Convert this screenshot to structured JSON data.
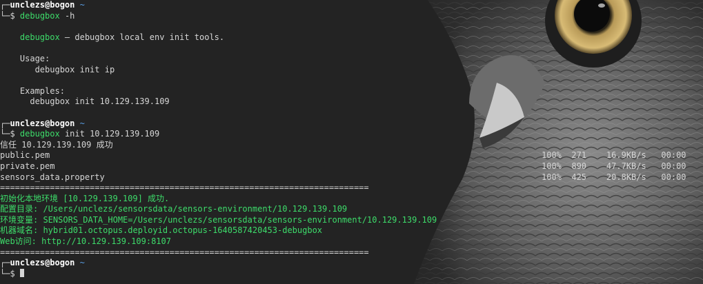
{
  "prompt": {
    "frame_top": "┌─",
    "frame_bottom": "└─",
    "user_host": "unclezs@bogon",
    "path": "~",
    "symbol": "$"
  },
  "session1": {
    "command_name": "debugbox",
    "command_args": " -h",
    "help_title_name": "debugbox",
    "help_title_rest": " — debugbox local env init tools.",
    "usage_label": "Usage:",
    "usage_cmd": "debugbox init ip",
    "examples_label": "Examples:",
    "examples_cmd": "debugbox init 10.129.139.109"
  },
  "session2": {
    "command_name": "debugbox",
    "command_args": " init 10.129.139.109",
    "trust_msg": "信任 10.129.139.109 成功",
    "transfers": [
      {
        "name": "public.pem",
        "stats": "100%  271    16.9KB/s   00:00"
      },
      {
        "name": "private.pem",
        "stats": "100%  890    47.7KB/s   00:00"
      },
      {
        "name": "sensors_data.property",
        "stats": "100%  425    20.8KB/s   00:00"
      }
    ],
    "rule": "==========================================================================",
    "result_lines": [
      "初始化本地环境 [10.129.139.109] 成功.",
      "配置目录: /Users/unclezs/sensorsdata/sensors-environment/10.129.139.109",
      "环境变量: SENSORS_DATA_HOME=/Users/unclezs/sensorsdata/sensors-environment/10.129.139.109",
      "机器域名: hybrid01.octopus.deployid.octopus-1640587420453-debugbox",
      "Web访问: http://10.129.139.109:8107"
    ]
  },
  "colors": {
    "background": "#232323",
    "command_green": "#3ddc6a",
    "tilde_blue": "#5aa0e6"
  },
  "wallpaper_icon": "owl-wallpaper"
}
